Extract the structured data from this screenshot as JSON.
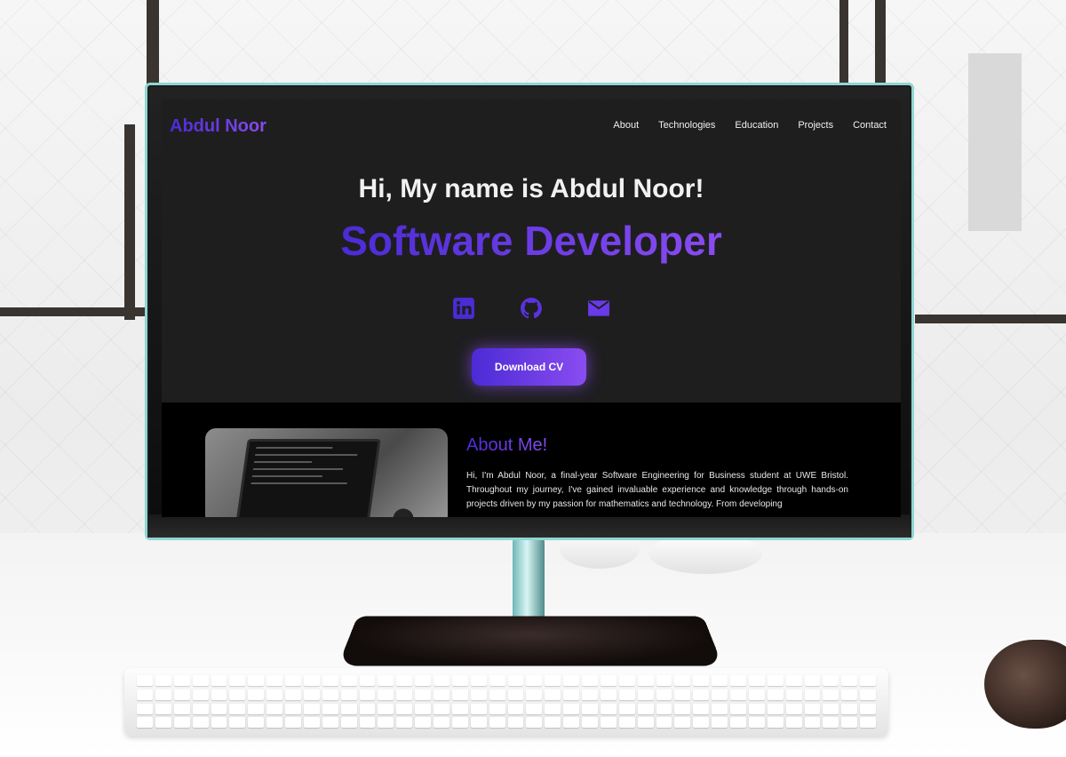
{
  "site": {
    "brand": "Abdul Noor",
    "nav": [
      "About",
      "Technologies",
      "Education",
      "Projects",
      "Contact"
    ],
    "hero": {
      "greeting": "Hi, My name is Abdul Noor!",
      "role": "Software Developer",
      "cta": "Download CV",
      "social_icons": [
        "linkedin-icon",
        "github-icon",
        "email-icon"
      ]
    },
    "about": {
      "title": "About Me!",
      "text": "Hi, I'm Abdul Noor, a final-year Software Engineering for Business student at UWE Bristol. Throughout my journey, I've gained invaluable experience and knowledge through hands-on projects driven by my passion for mathematics and technology. From developing"
    }
  },
  "colors": {
    "accent_start": "#4b2bd6",
    "accent_end": "#8a4cf0",
    "screen_bg": "#1e1e1f",
    "about_bg": "#000000"
  }
}
